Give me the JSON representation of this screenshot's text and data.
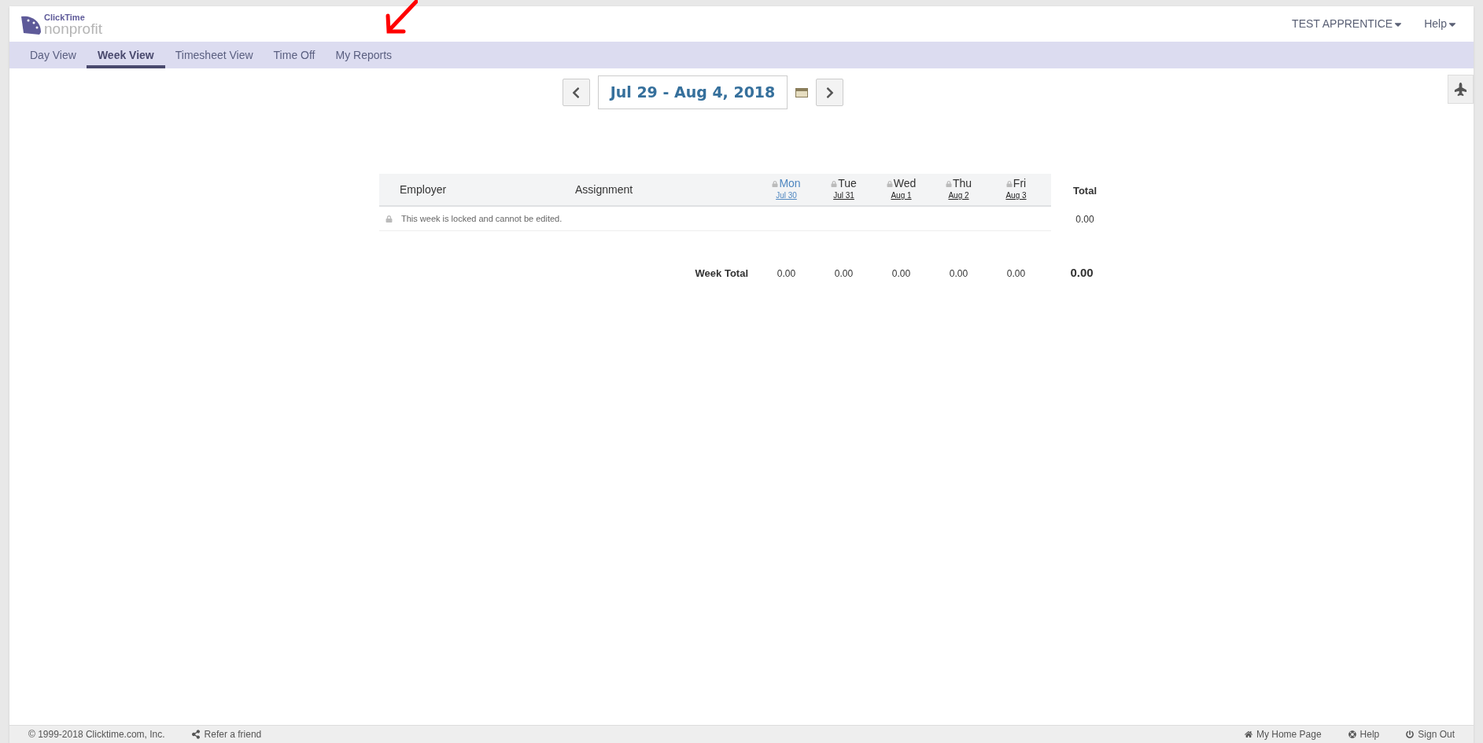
{
  "logo": {
    "brand": "ClickTime",
    "product": "nonprofit"
  },
  "user_menu": {
    "label": "TEST APPRENTICE"
  },
  "help_menu": {
    "label": "Help"
  },
  "tabs": [
    {
      "label": "Day View",
      "selected": false
    },
    {
      "label": "Week View",
      "selected": true
    },
    {
      "label": "Timesheet View",
      "selected": false
    },
    {
      "label": "Time Off",
      "selected": false
    },
    {
      "label": "My Reports",
      "selected": false
    }
  ],
  "date_range": "Jul 29 - Aug 4, 2018",
  "table": {
    "columns": [
      "Employer",
      "Assignment"
    ],
    "days": [
      {
        "name": "Mon",
        "date": "Jul 30",
        "locked": true,
        "selected": true
      },
      {
        "name": "Tue",
        "date": "Jul 31",
        "locked": true,
        "selected": false
      },
      {
        "name": "Wed",
        "date": "Aug 1",
        "locked": true,
        "selected": false
      },
      {
        "name": "Thu",
        "date": "Aug 2",
        "locked": true,
        "selected": false
      },
      {
        "name": "Fri",
        "date": "Aug 3",
        "locked": true,
        "selected": false
      }
    ],
    "total_heading": "Total",
    "locked_message": "This week is locked and cannot be edited.",
    "row_total": "0.00",
    "week_total_label": "Week Total",
    "week_totals": [
      "0.00",
      "0.00",
      "0.00",
      "0.00",
      "0.00"
    ],
    "grand_total": "0.00"
  },
  "footer": {
    "copyright": "© 1999-2018 Clicktime.com, Inc.",
    "refer": "Refer a friend",
    "links": [
      {
        "kind": "home",
        "label": "My Home Page"
      },
      {
        "kind": "help",
        "label": "Help"
      },
      {
        "kind": "signout",
        "label": "Sign Out"
      }
    ]
  }
}
